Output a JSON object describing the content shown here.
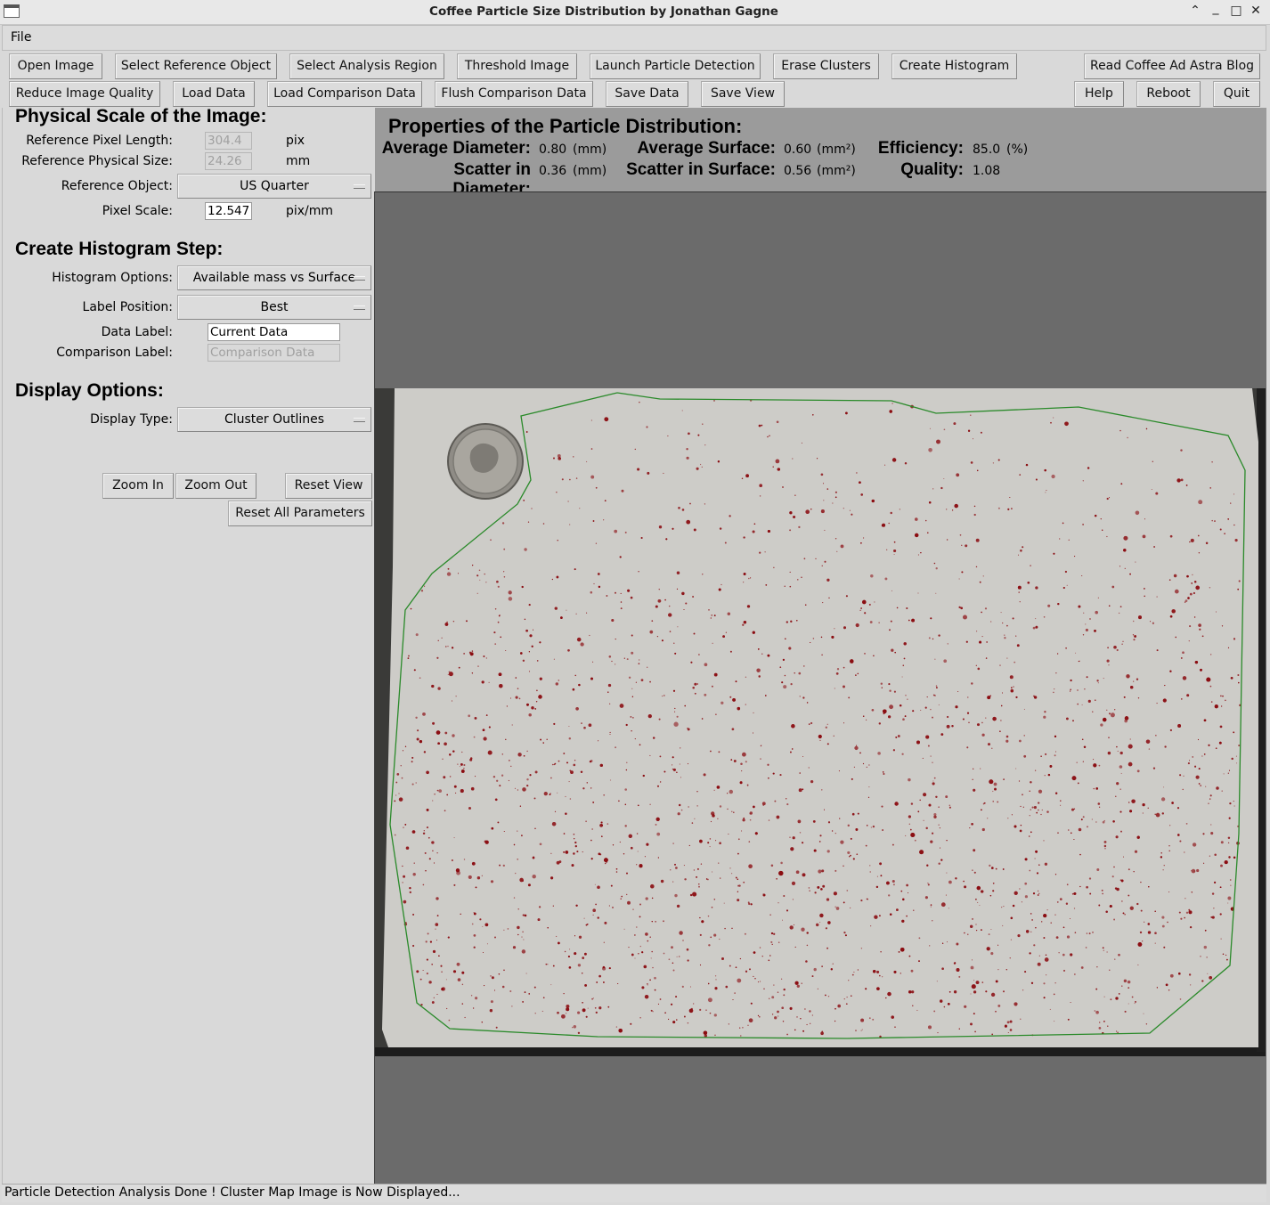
{
  "window": {
    "title": "Coffee Particle Size Distribution by Jonathan Gagne",
    "controls": [
      "⌃",
      "_",
      "□",
      "✕"
    ]
  },
  "menu": {
    "file": "File"
  },
  "toolbar": {
    "row1": [
      "Open Image",
      "Select Reference Object",
      "Select Analysis Region",
      "Threshold Image",
      "Launch Particle Detection",
      "Erase Clusters",
      "Create Histogram",
      "Read Coffee Ad Astra Blog"
    ],
    "row2": [
      "Reduce Image Quality",
      "Load Data",
      "Load Comparison Data",
      "Flush Comparison Data",
      "Save Data",
      "Save View",
      "Help",
      "Reboot",
      "Quit"
    ]
  },
  "scale": {
    "heading": "Physical Scale of the Image:",
    "ref_pixel_length_label": "Reference Pixel Length:",
    "ref_pixel_length_value": "304.4",
    "ref_pixel_length_unit": "pix",
    "ref_physical_size_label": "Reference Physical Size:",
    "ref_physical_size_value": "24.26",
    "ref_physical_size_unit": "mm",
    "ref_object_label": "Reference Object:",
    "ref_object_value": "US Quarter",
    "pixel_scale_label": "Pixel Scale:",
    "pixel_scale_value": "12.547",
    "pixel_scale_unit": "pix/mm"
  },
  "histogram": {
    "heading": "Create Histogram Step:",
    "options_label": "Histogram Options:",
    "options_value": "Available mass vs Surface",
    "label_position_label": "Label Position:",
    "label_position_value": "Best",
    "data_label_label": "Data Label:",
    "data_label_value": "Current Data",
    "comparison_label_label": "Comparison Label:",
    "comparison_label_value": "Comparison Data"
  },
  "display": {
    "heading": "Display Options:",
    "type_label": "Display Type:",
    "type_value": "Cluster Outlines"
  },
  "view_buttons": {
    "zoom_in": "Zoom In",
    "zoom_out": "Zoom Out",
    "reset_view": "Reset View",
    "reset_all": "Reset All Parameters"
  },
  "properties": {
    "heading": "Properties of the Particle Distribution:",
    "avg_diameter_label": "Average Diameter:",
    "avg_diameter_value": "0.80",
    "avg_diameter_unit": "(mm)",
    "scatter_diameter_label": "Scatter in Diameter:",
    "scatter_diameter_value": "0.36",
    "scatter_diameter_unit": "(mm)",
    "avg_surface_label": "Average Surface:",
    "avg_surface_value": "0.60",
    "avg_surface_unit": "(mm²)",
    "scatter_surface_label": "Scatter in Surface:",
    "scatter_surface_value": "0.56",
    "scatter_surface_unit": "(mm²)",
    "efficiency_label": "Efficiency:",
    "efficiency_value": "85.0",
    "efficiency_unit": "(%)",
    "quality_label": "Quality:",
    "quality_value": "1.08"
  },
  "colors": {
    "region_outline": "#2a8a2a",
    "particles": "#8b0d12",
    "paper": "#cdccc8",
    "canvas_bg": "#6b6b6b",
    "props_bg": "#9b9b9b"
  },
  "status": {
    "text": "Particle Detection Analysis Done ! Cluster Map Image is Now Displayed..."
  }
}
